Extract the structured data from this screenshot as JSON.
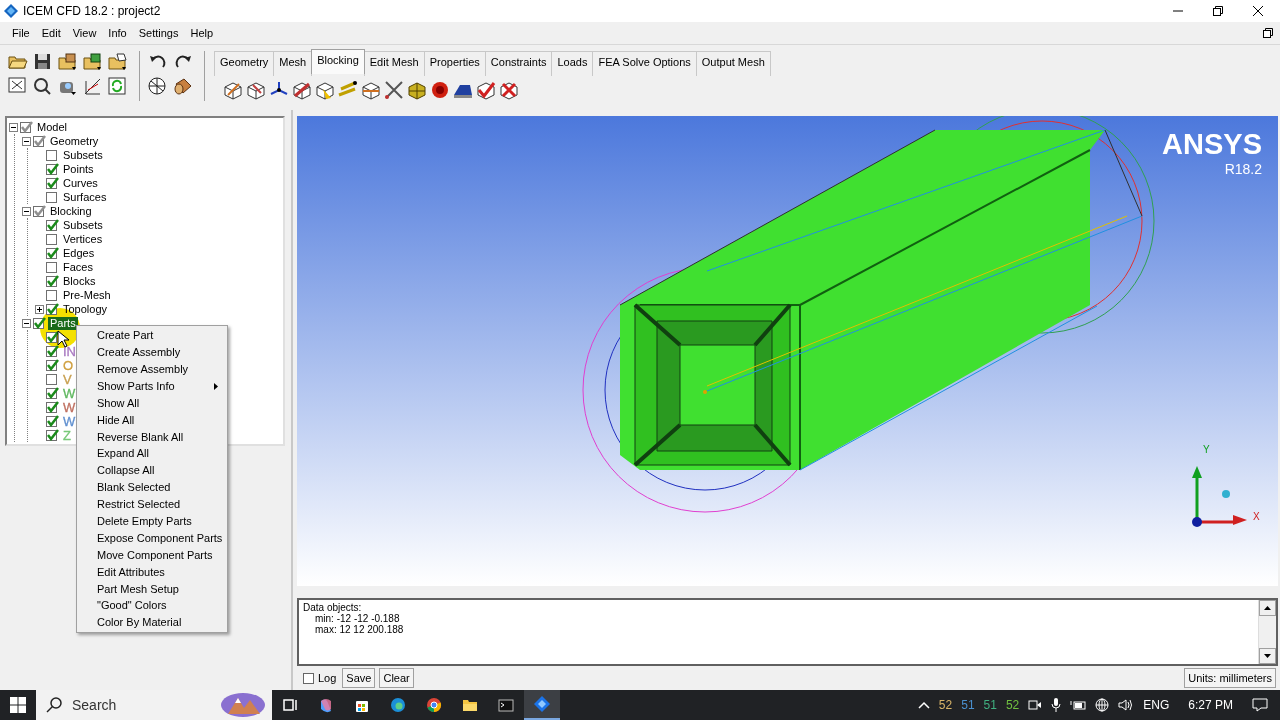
{
  "window": {
    "title": "ICEM CFD 18.2 : project2"
  },
  "menu_bar": [
    "File",
    "Edit",
    "View",
    "Info",
    "Settings",
    "Help"
  ],
  "ribbon_tabs": [
    {
      "label": "Geometry",
      "selected": false
    },
    {
      "label": "Mesh",
      "selected": false
    },
    {
      "label": "Blocking",
      "selected": true
    },
    {
      "label": "Edit Mesh",
      "selected": false
    },
    {
      "label": "Properties",
      "selected": false
    },
    {
      "label": "Constraints",
      "selected": false
    },
    {
      "label": "Loads",
      "selected": false
    },
    {
      "label": "FEA Solve Options",
      "selected": false
    },
    {
      "label": "Output Mesh",
      "selected": false
    }
  ],
  "tree": [
    {
      "label": "Model",
      "checked": true,
      "greyed": true,
      "expanded": true,
      "selected": false,
      "children": [
        {
          "label": "Geometry",
          "checked": true,
          "greyed": true,
          "expanded": true,
          "selected": false,
          "children": [
            {
              "label": "Subsets",
              "checked": false,
              "selected": false
            },
            {
              "label": "Points",
              "checked": true,
              "selected": false
            },
            {
              "label": "Curves",
              "checked": true,
              "selected": false
            },
            {
              "label": "Surfaces",
              "checked": false,
              "selected": false
            }
          ]
        },
        {
          "label": "Blocking",
          "checked": true,
          "greyed": true,
          "expanded": true,
          "selected": false,
          "children": [
            {
              "label": "Subsets",
              "checked": true,
              "selected": false
            },
            {
              "label": "Vertices",
              "checked": false,
              "selected": false
            },
            {
              "label": "Edges",
              "checked": true,
              "selected": false
            },
            {
              "label": "Faces",
              "checked": false,
              "selected": false
            },
            {
              "label": "Blocks",
              "checked": true,
              "selected": false
            },
            {
              "label": "Pre-Mesh",
              "checked": false,
              "selected": false
            },
            {
              "label": "Topology",
              "checked": true,
              "expanded": false,
              "selected": false
            }
          ]
        },
        {
          "label": "Parts",
          "checked": true,
          "expanded": true,
          "selected": true,
          "children": [
            {
              "checked": true,
              "selected": false
            },
            {
              "label": "IN",
              "checked": true,
              "selected": false,
              "color": "#a878c0"
            },
            {
              "label": "O",
              "checked": true,
              "selected": false,
              "color": "#d0a040"
            },
            {
              "label": "V",
              "checked": false,
              "selected": false,
              "color": "#c8a050"
            },
            {
              "label": "W",
              "checked": true,
              "selected": false,
              "color": "#60b860"
            },
            {
              "label": "W",
              "checked": true,
              "selected": false,
              "color": "#c07060"
            },
            {
              "label": "W",
              "checked": true,
              "selected": false,
              "color": "#6090d0"
            },
            {
              "label": "Z",
              "checked": true,
              "selected": false,
              "color": "#78c878"
            }
          ]
        }
      ]
    }
  ],
  "context_menu": [
    {
      "label": "Create Part",
      "submenu": false
    },
    {
      "label": "Create Assembly",
      "submenu": false
    },
    {
      "label": "Remove Assembly",
      "submenu": false
    },
    {
      "label": "Show Parts Info",
      "submenu": true
    },
    {
      "label": "Show All",
      "submenu": false
    },
    {
      "label": "Hide All",
      "submenu": false
    },
    {
      "label": "Reverse Blank All",
      "submenu": false
    },
    {
      "label": "Expand All",
      "submenu": false
    },
    {
      "label": "Collapse All",
      "submenu": false
    },
    {
      "label": "Blank Selected",
      "submenu": false
    },
    {
      "label": "Restrict Selected",
      "submenu": false
    },
    {
      "label": "Delete Empty Parts",
      "submenu": false
    },
    {
      "label": "Expose Component Parts",
      "submenu": false
    },
    {
      "label": "Move Component Parts",
      "submenu": false
    },
    {
      "label": "Edit Attributes",
      "submenu": false
    },
    {
      "label": "Part Mesh Setup",
      "submenu": false
    },
    {
      "label": "\"Good\" Colors",
      "submenu": false
    },
    {
      "label": "Color By Material",
      "submenu": false
    }
  ],
  "viewport": {
    "logo": "ANSYS",
    "version": "R18.2",
    "axis_labels": [
      "Y",
      "X"
    ]
  },
  "messages": {
    "lines": [
      "Data objects:",
      "min: -12 -12 -0.188",
      "max: 12 12 200.188"
    ],
    "log": {
      "label": "Log",
      "checked": false
    },
    "buttons": [
      "Save",
      "Clear"
    ],
    "units": "Units: millimeters"
  },
  "taskbar": {
    "search": {
      "placeholder": "Search"
    },
    "tray_counters": [
      {
        "text": "52",
        "color": "#d8b468"
      },
      {
        "text": "51",
        "color": "#4a90d0"
      },
      {
        "text": "51",
        "color": "#40b080"
      },
      {
        "text": "52",
        "color": "#70c040"
      }
    ],
    "language": "ENG",
    "time": "6:27 PM"
  }
}
